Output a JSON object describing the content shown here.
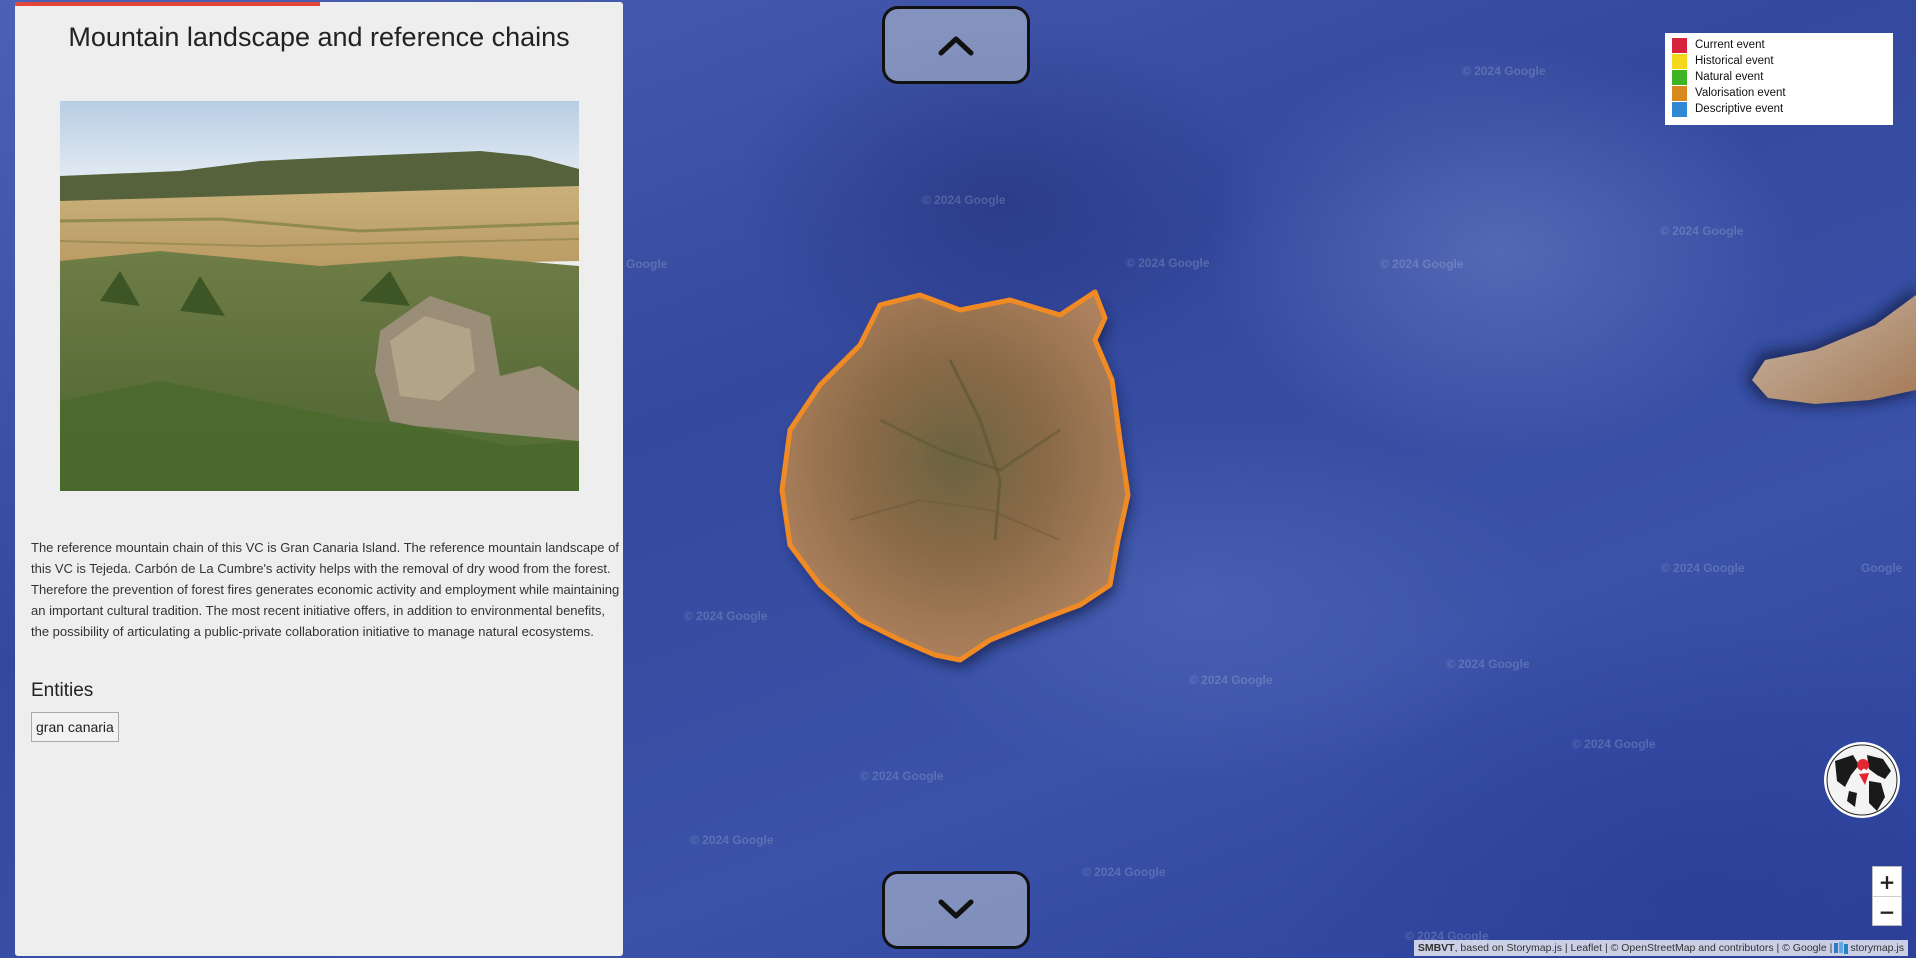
{
  "story": {
    "title": "Mountain landscape and reference chains",
    "description": "The reference mountain chain of this VC is Gran Canaria Island. The reference mountain landscape of this VC is Tejeda. Carbón de La Cumbre's activity helps with the removal of dry wood from the forest. Therefore the prevention of forest fires generates economic activity and employment while maintaining an important cultural tradition. The most recent initiative offers, in addition to environmental benefits, the possibility of articulating a public-private collaboration initiative to manage natural ecosystems.",
    "entities_heading": "Entities",
    "entities": [
      "gran canaria"
    ]
  },
  "legend": [
    {
      "label": "Current event",
      "color": "#d6243d"
    },
    {
      "label": "Historical event",
      "color": "#f4d81c"
    },
    {
      "label": "Natural event",
      "color": "#3db424"
    },
    {
      "label": "Valorisation event",
      "color": "#d98a1f"
    },
    {
      "label": "Descriptive event",
      "color": "#2f89d4"
    }
  ],
  "map": {
    "watermark": "© 2024 Google",
    "watermark_partial": "Google",
    "highlight_color": "#f08a24",
    "zoom_in": "+",
    "zoom_out": "−"
  },
  "attribution": {
    "brand": "SMBVT",
    "text": ", based on Storymap.js | Leaflet | © OpenStreetMap and contributors | © Google |",
    "logo_text": "storymap.js"
  },
  "icons": {
    "nav_up": "chevron-up-icon",
    "nav_down": "chevron-down-icon",
    "globe": "globe-locator-icon"
  }
}
